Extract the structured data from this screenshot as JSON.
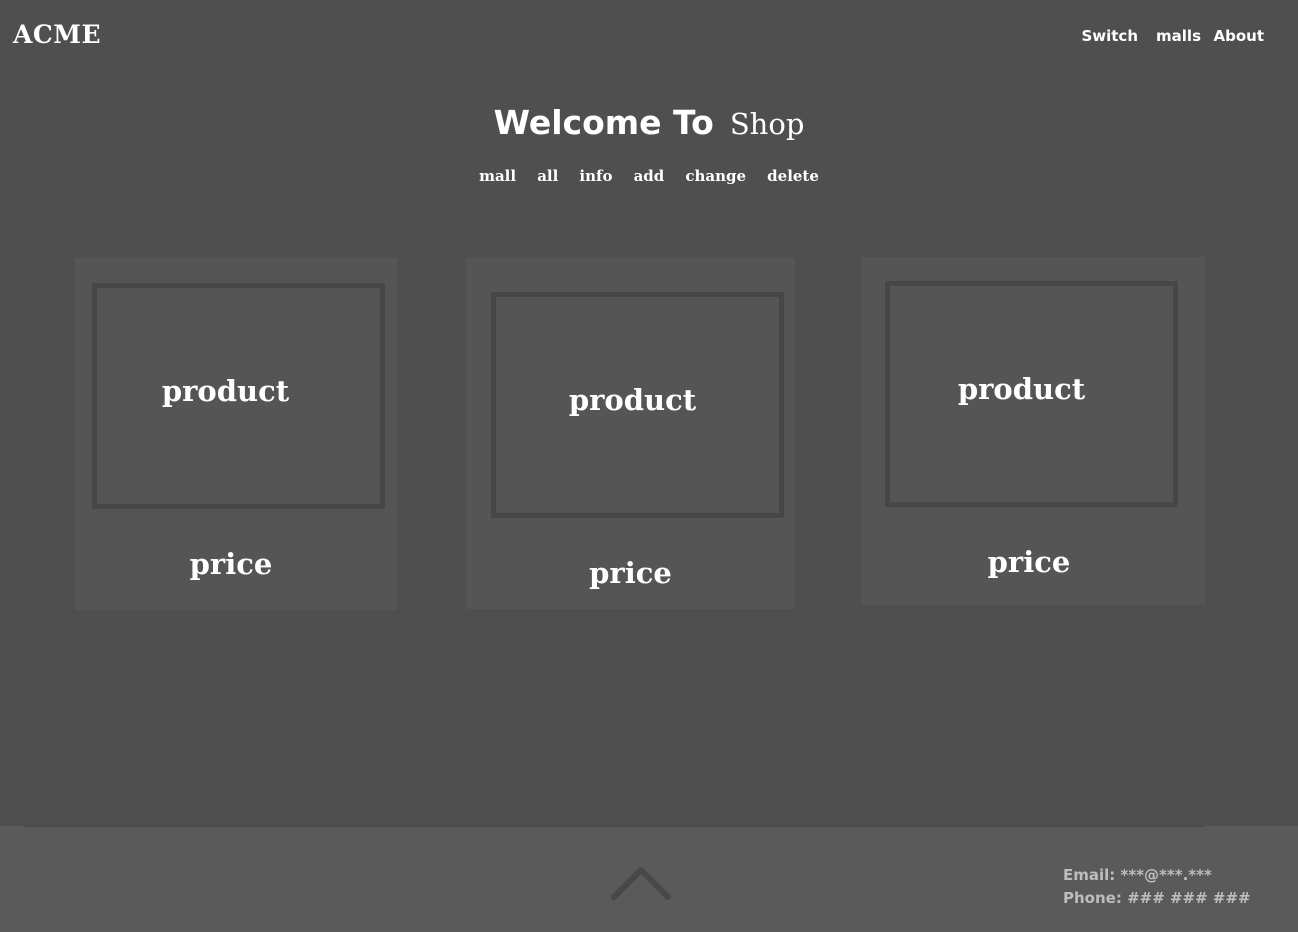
{
  "header": {
    "logo": "ACME",
    "nav": [
      {
        "label": "Switch"
      },
      {
        "label": "malls"
      },
      {
        "label": "About"
      }
    ]
  },
  "hero": {
    "welcome": "Welcome To",
    "shop": "Shop"
  },
  "sub_nav": [
    {
      "label": "mall"
    },
    {
      "label": "all"
    },
    {
      "label": "info"
    },
    {
      "label": "add"
    },
    {
      "label": "change"
    },
    {
      "label": "delete"
    }
  ],
  "products": [
    {
      "name": "product",
      "price": "price"
    },
    {
      "name": "product",
      "price": "price"
    },
    {
      "name": "product",
      "price": "price"
    }
  ],
  "footer": {
    "back_to_top_icon": "chevron-up-icon",
    "email_label": "Email:",
    "email_value": "***@***.***",
    "phone_label": "Phone:",
    "phone_value": "### ### ###"
  },
  "colors": {
    "background": "#4f4f4f",
    "card": "#555555",
    "card_border": "#474747",
    "footer": "#5a5a5a",
    "text": "#ffffff",
    "footer_text": "#bdbdbd"
  }
}
